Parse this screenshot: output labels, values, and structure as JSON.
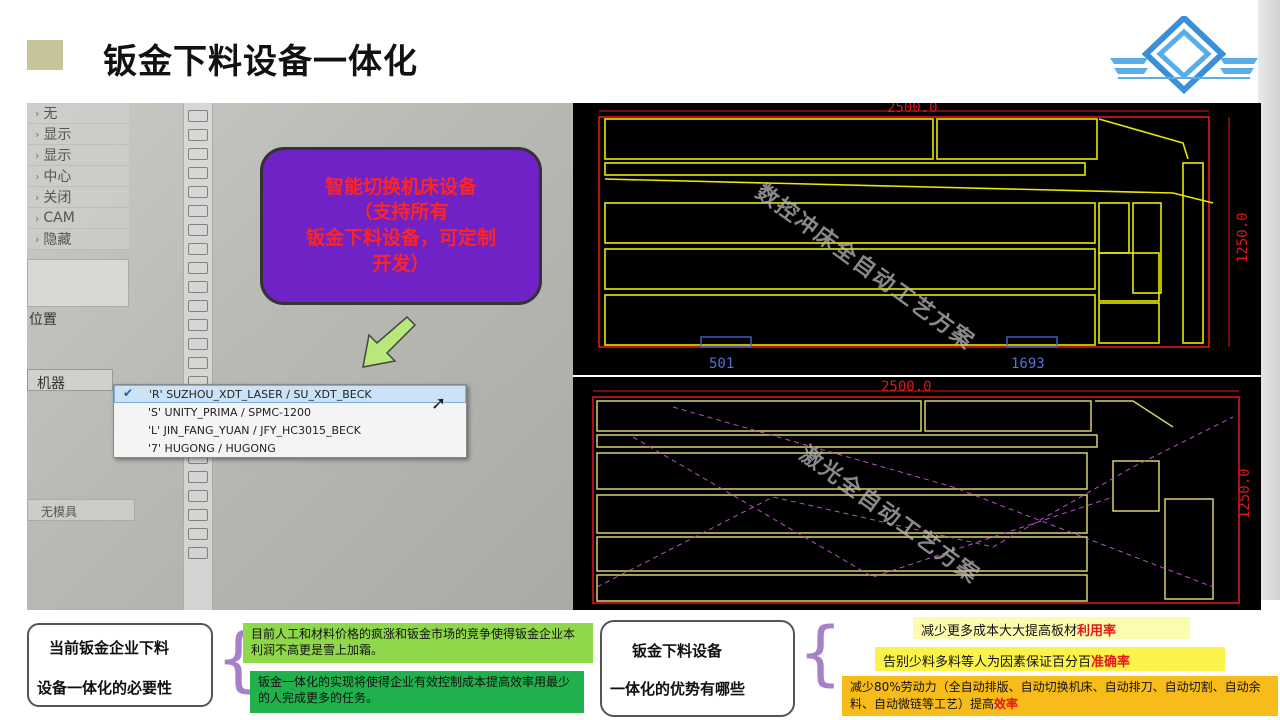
{
  "slide": {
    "title": "钣金下料设备一体化"
  },
  "photo": {
    "menu_items": [
      "无",
      "显示",
      "显示",
      "中心",
      "关闭",
      "CAM",
      "隐藏"
    ],
    "location_label": "位置",
    "machine_label": "机器",
    "mold_label": "无模具",
    "callout": {
      "line1": "智能切换机床设备",
      "line2": "（支持所有",
      "line3": "钣金下料设备，可定制",
      "line4": "开发）",
      "fill_color": "#6f22c6",
      "text_color": "#ff2424"
    },
    "dropdown": {
      "selected_index": 0,
      "options": [
        "'R'  SUZHOU_XDT_LASER / SU_XDT_BECK",
        "'S'  UNITY_PRIMA / SPMC-1200",
        "'L'  JIN_FANG_YUAN / JFY_HC3015_BECK",
        "'7'  HUGONG / HUGONG"
      ]
    }
  },
  "cad_top": {
    "width_dim": "2500.0",
    "height_dim": "1250.0",
    "marker_left": "501",
    "marker_right": "1693",
    "watermark": "数控冲床全自动工艺方案"
  },
  "cad_bottom": {
    "width_dim": "2500.0",
    "height_dim": "1250.0",
    "watermark": "激光全自动工艺方案"
  },
  "summary": {
    "necessity_line1": "当前钣金企业下料",
    "necessity_line2": "设备一体化的必要性",
    "note1": "目前人工和材料价格的疯涨和钣金市场的竞争使得钣金企业本利润不高更是雪上加霜。",
    "note2": "钣金一体化的实现将使得企业有效控制成本提高效率用最少的人完成更多的任务。",
    "advantages_line1": "钣金下料设备",
    "advantages_line2": "一体化的优势有哪些",
    "adv1_text": "减少更多成本大大提高板材",
    "adv1_highlight": "利用率",
    "adv2_text": "告别少料多料等人为因素保证百分百",
    "adv2_highlight": "准确率",
    "adv3_text": "减少80%劳动力（全自动排版、自动切换机床、自动排刀、自动切割、自动余料、自动微链等工艺）提高",
    "adv3_highlight": "效率"
  },
  "colors": {
    "cad_line": "#e8e800",
    "cad_dim": "#e0181a",
    "accent_green": "#8ed84a",
    "dark_green": "#20b04c",
    "brace": "#a680c8"
  }
}
